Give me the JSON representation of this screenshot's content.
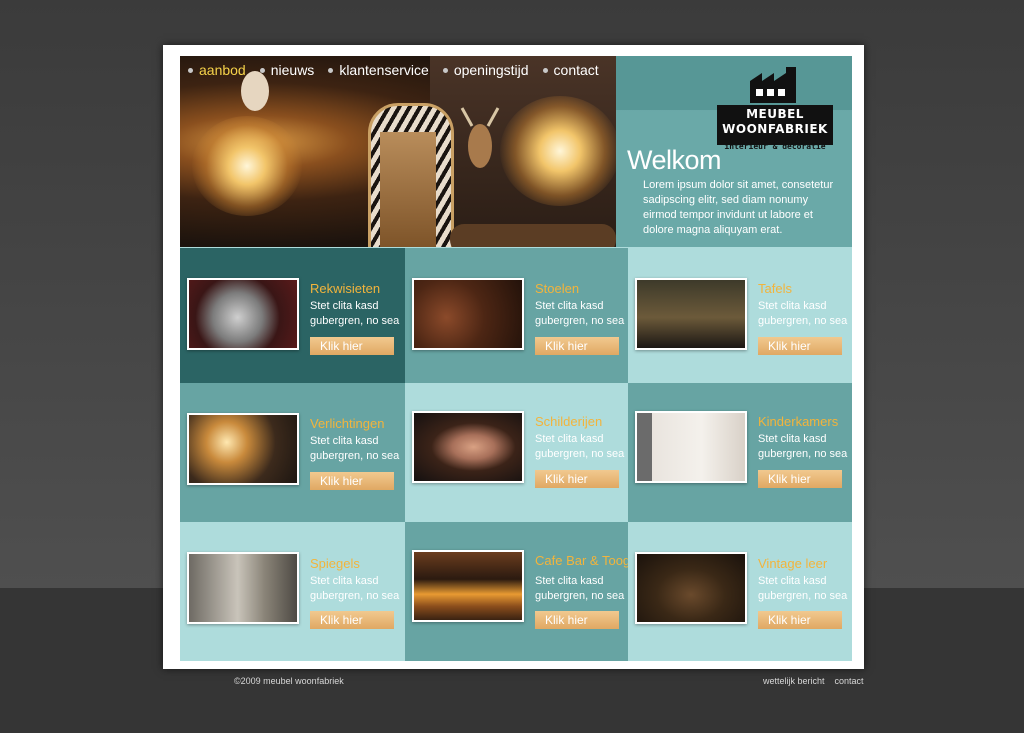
{
  "nav": {
    "items": [
      {
        "label": "aanbod",
        "active": true
      },
      {
        "label": "nieuws",
        "active": false
      },
      {
        "label": "klantenservice",
        "active": false
      },
      {
        "label": "openingstijd",
        "active": false
      },
      {
        "label": "contact",
        "active": false
      }
    ]
  },
  "logo": {
    "line1": "MEUBEL",
    "line2": "WOONFABRIEK",
    "tagline": "interieur & decoratie"
  },
  "welcome": {
    "title": "Welkom",
    "text": "Lorem ipsum dolor sit amet, consetetur sadipscing elitr, sed diam nonumy eirmod tempor invidunt ut labore et dolore magna aliquyam erat."
  },
  "categories": [
    {
      "title": "Rekwisieten",
      "desc": "Stet clita kasd gubergren, no sea",
      "button": "Klik hier",
      "image": "armor-helmet"
    },
    {
      "title": "Stoelen",
      "desc": "Stet clita kasd gubergren, no sea",
      "button": "Klik hier",
      "image": "leather-chairs"
    },
    {
      "title": "Tafels",
      "desc": "Stet clita kasd gubergren, no sea",
      "button": "Klik hier",
      "image": "dining-table"
    },
    {
      "title": "Verlichtingen",
      "desc": "Stet clita kasd gubergren, no sea",
      "button": "Klik hier",
      "image": "chandelier"
    },
    {
      "title": "Schilderijen",
      "desc": "Stet clita kasd gubergren, no sea",
      "button": "Klik hier",
      "image": "portrait-painting"
    },
    {
      "title": "Kinderkamers",
      "desc": "Stet clita kasd gubergren, no sea",
      "button": "Klik hier",
      "image": "bright-room"
    },
    {
      "title": "Spiegels",
      "desc": "Stet clita kasd gubergren, no sea",
      "button": "Klik hier",
      "image": "ornate-mirror"
    },
    {
      "title": "Cafe Bar & Toog",
      "desc": "Stet clita kasd gubergren, no sea",
      "button": "Klik hier",
      "image": "cafe-bar"
    },
    {
      "title": "Vintage leer",
      "desc": "Stet clita kasd gubergren, no sea",
      "button": "Klik hier",
      "image": "leather-sofa"
    }
  ],
  "colors": {
    "dark": "#2b6464",
    "mid": "#67a4a3",
    "light": "#aedcdc",
    "accent": "#f2b43c",
    "button": "#e8b778",
    "nav_active": "#f6d34a"
  },
  "footer": {
    "copyright": "©2009  meubel woonfabriek",
    "links": [
      "wettelijk bericht",
      "contact"
    ]
  }
}
